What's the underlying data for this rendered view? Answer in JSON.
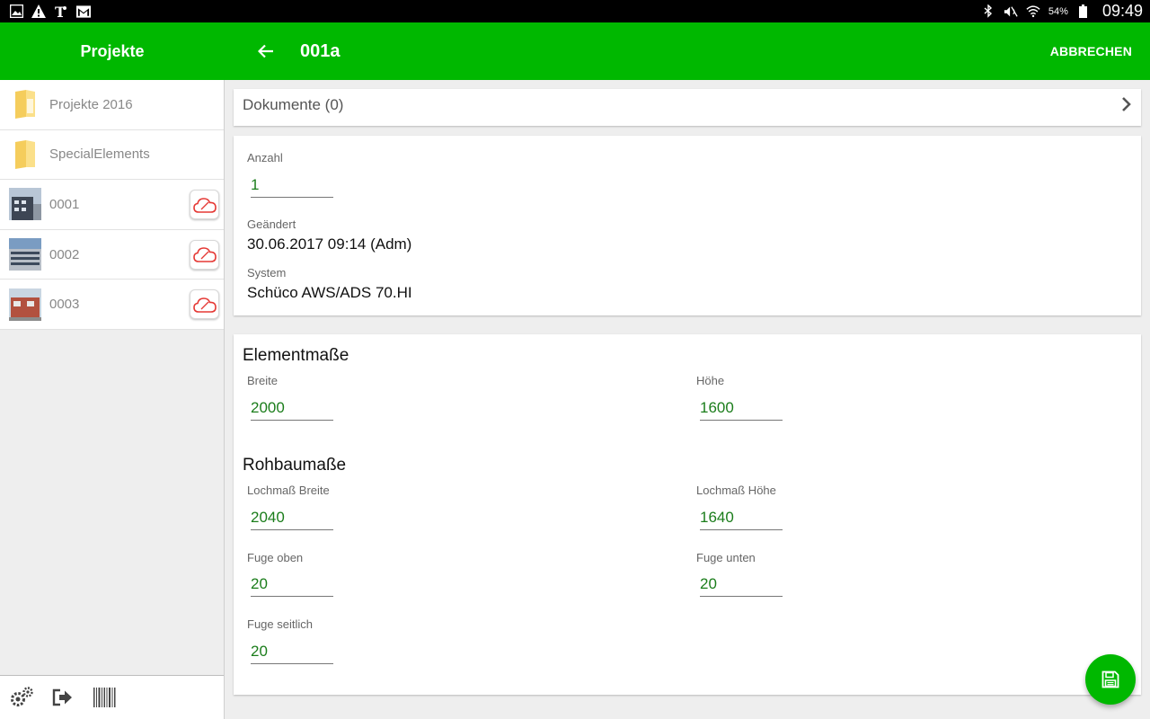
{
  "status_bar": {
    "battery_percent": "54%",
    "time": "09:49",
    "icons": [
      "gallery-icon",
      "warning-icon",
      "news-icon",
      "mail-icon",
      "bluetooth-icon",
      "mute-icon",
      "wifi-icon",
      "battery-icon"
    ]
  },
  "sidebar": {
    "title": "Projekte",
    "items": [
      {
        "label": "Projekte 2016",
        "type": "folder"
      },
      {
        "label": "SpecialElements",
        "type": "folder"
      },
      {
        "label": "0001",
        "type": "project"
      },
      {
        "label": "0002",
        "type": "project"
      },
      {
        "label": "0003",
        "type": "project"
      }
    ],
    "footer_icons": [
      "settings-icon",
      "logout-icon",
      "barcode-icon"
    ]
  },
  "header": {
    "title": "001a",
    "action_label": "ABBRECHEN"
  },
  "documents": {
    "label": "Dokumente (0)"
  },
  "info": {
    "anzahl_label": "Anzahl",
    "anzahl_value": "1",
    "geaendert_label": "Geändert",
    "geaendert_value": "30.06.2017 09:14 (Adm)",
    "system_label": "System",
    "system_value": "Schüco AWS/ADS 70.HI"
  },
  "element_dims": {
    "title": "Elementmaße",
    "breite_label": "Breite",
    "breite_value": "2000",
    "hoehe_label": "Höhe",
    "hoehe_value": "1600"
  },
  "rohbau_dims": {
    "title": "Rohbaumaße",
    "lochmass_breite_label": "Lochmaß Breite",
    "lochmass_breite_value": "2040",
    "lochmass_hoehe_label": "Lochmaß Höhe",
    "lochmass_hoehe_value": "1640",
    "fuge_oben_label": "Fuge oben",
    "fuge_oben_value": "20",
    "fuge_unten_label": "Fuge unten",
    "fuge_unten_value": "20",
    "fuge_seitlich_label": "Fuge seitlich",
    "fuge_seitlich_value": "20"
  },
  "colors": {
    "accent": "#00b800",
    "value_text": "#1b7d1b",
    "cloud_icon": "#e53935"
  }
}
